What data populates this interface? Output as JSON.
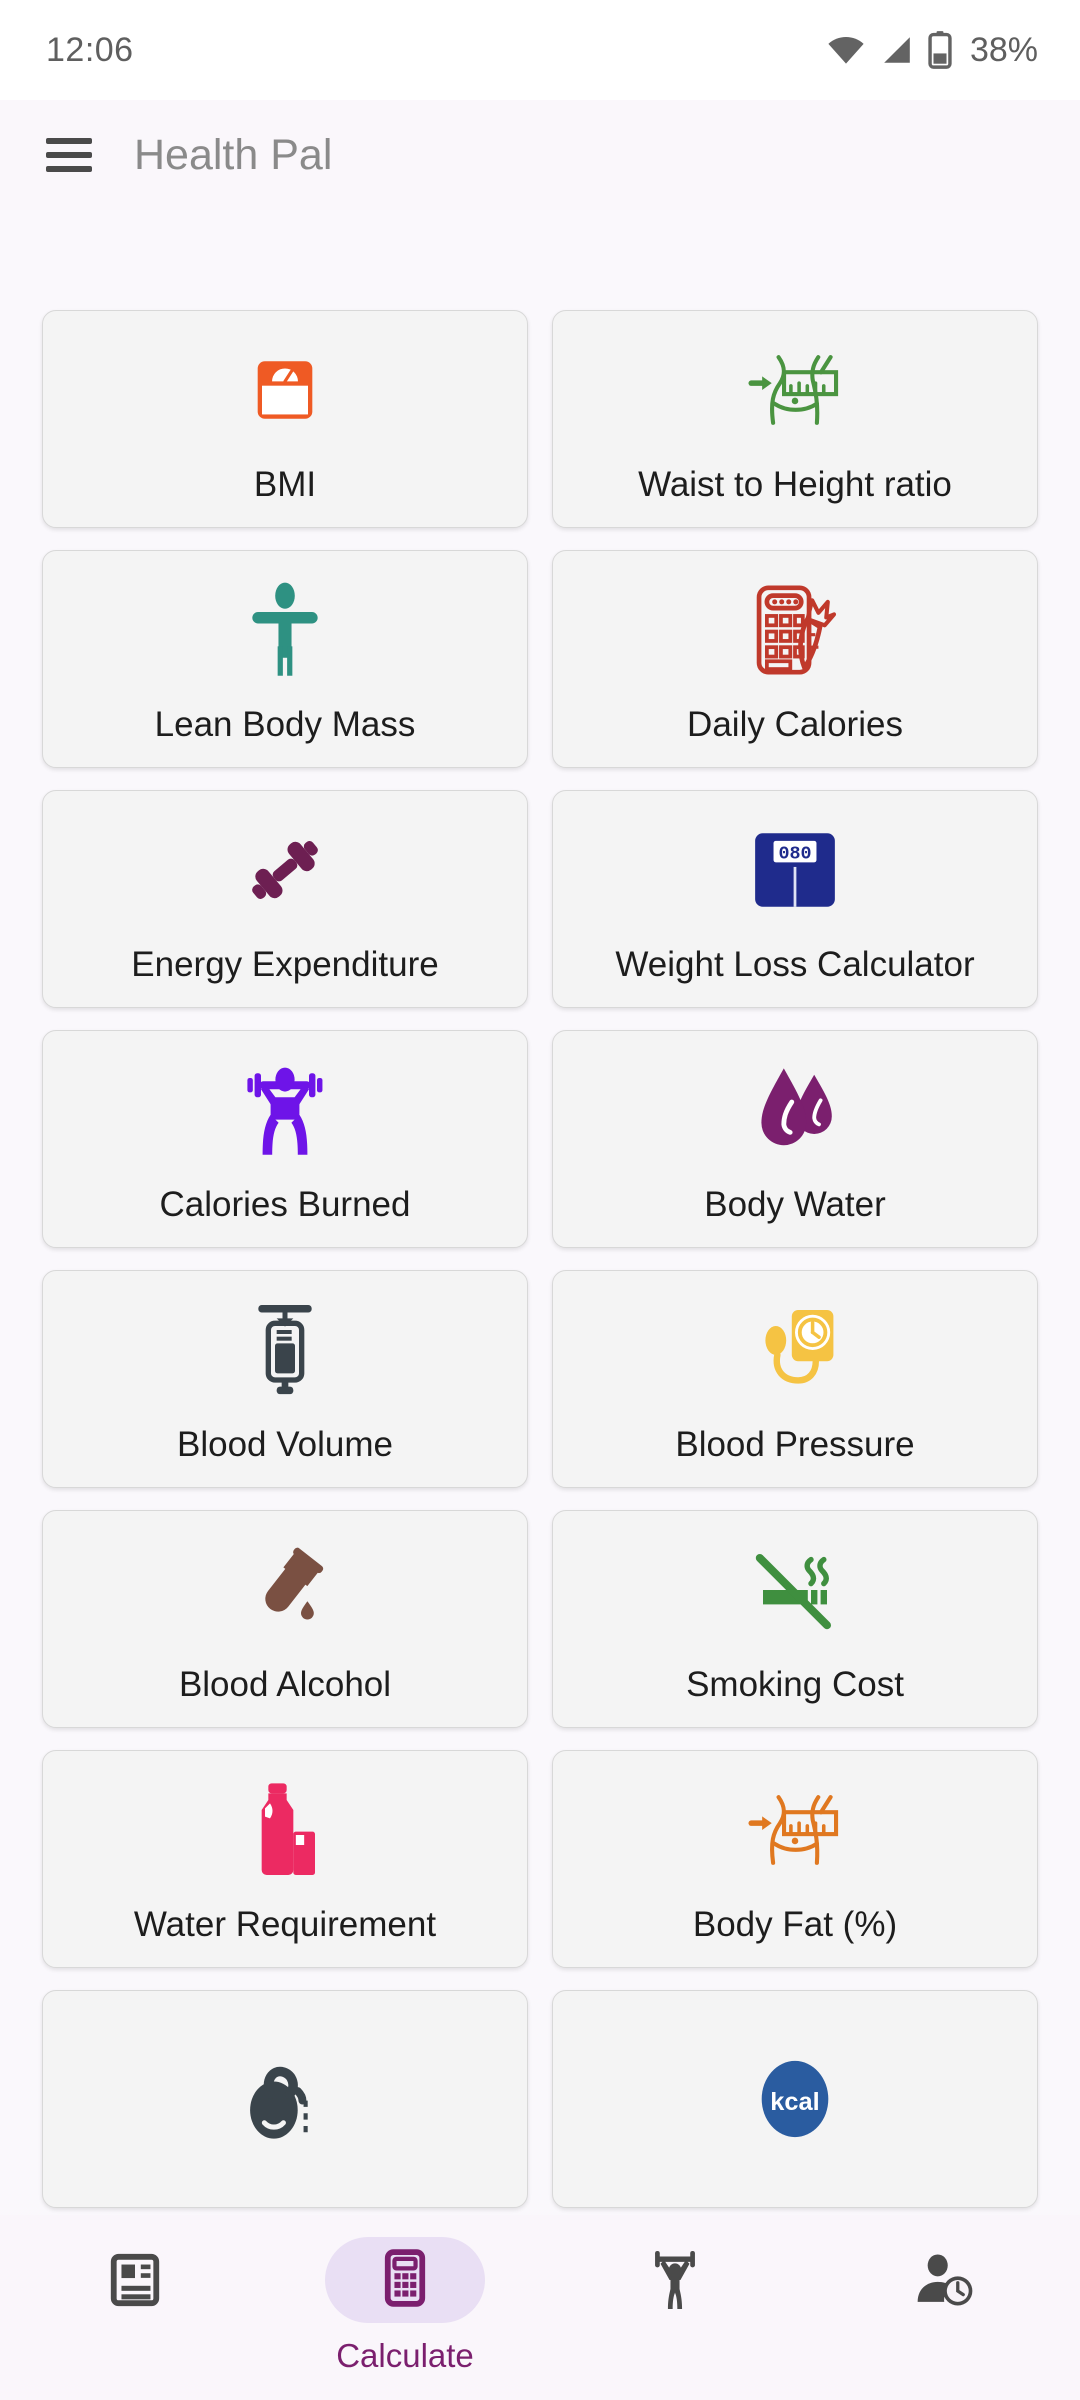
{
  "status_bar": {
    "time": "12:06",
    "battery_percent": "38%",
    "icons": [
      "wifi-icon",
      "cellular-signal-icon",
      "battery-icon"
    ]
  },
  "app_bar": {
    "menu_icon": "hamburger-menu-icon",
    "title": "Health Pal"
  },
  "colors": {
    "page_background": "#faf8fc",
    "card_background": "#f4f4f4",
    "card_border": "#d8d8d8",
    "accent_purple": "#7b1f6e",
    "nav_pill": "#e9dff4",
    "title_gray": "#8a8a8a"
  },
  "grid": {
    "cards": [
      {
        "label": "BMI",
        "icon": "weighing-scale-icon",
        "color": "#ef5a24"
      },
      {
        "label": "Waist to Height ratio",
        "icon": "waist-measure-icon",
        "color": "#4a9440"
      },
      {
        "label": "Lean Body Mass",
        "icon": "person-standing-icon",
        "color": "#2e9182"
      },
      {
        "label": "Daily Calories",
        "icon": "calculator-carrot-icon",
        "color": "#c0392b"
      },
      {
        "label": "Energy Expenditure",
        "icon": "dumbbell-icon",
        "color": "#6d1f52"
      },
      {
        "label": "Weight Loss Calculator",
        "icon": "digital-scale-icon",
        "color": "#1f2b8c",
        "display_value": "080"
      },
      {
        "label": "Calories Burned",
        "icon": "weightlifter-icon",
        "color": "#6e14e8"
      },
      {
        "label": "Body Water",
        "icon": "water-droplets-icon",
        "color": "#7b1f6e"
      },
      {
        "label": "Blood Volume",
        "icon": "iv-drip-icon",
        "color": "#3a444b"
      },
      {
        "label": "Blood Pressure",
        "icon": "blood-pressure-monitor-icon",
        "color": "#f5c343"
      },
      {
        "label": "Blood Alcohol",
        "icon": "test-tube-drop-icon",
        "color": "#7a5042"
      },
      {
        "label": "Smoking Cost",
        "icon": "no-smoking-icon",
        "color": "#3f8f3f"
      },
      {
        "label": "Water Requirement",
        "icon": "water-bottle-glass-icon",
        "color": "#ec2a62"
      },
      {
        "label": "Body Fat (%)",
        "icon": "waist-measure-icon",
        "color": "#e07820"
      },
      {
        "label": "",
        "icon": "pill-capsule-icon",
        "color": "#3a444b"
      },
      {
        "label": "",
        "icon": "kcal-badge-icon",
        "color": "#2a5ca0",
        "badge_text": "kcal"
      }
    ]
  },
  "bottom_nav": {
    "items": [
      {
        "label": "",
        "icon": "article-icon",
        "active": false
      },
      {
        "label": "Calculate",
        "icon": "calculator-icon",
        "active": true
      },
      {
        "label": "",
        "icon": "weightlifter-nav-icon",
        "active": false
      },
      {
        "label": "",
        "icon": "person-history-icon",
        "active": false
      }
    ]
  }
}
